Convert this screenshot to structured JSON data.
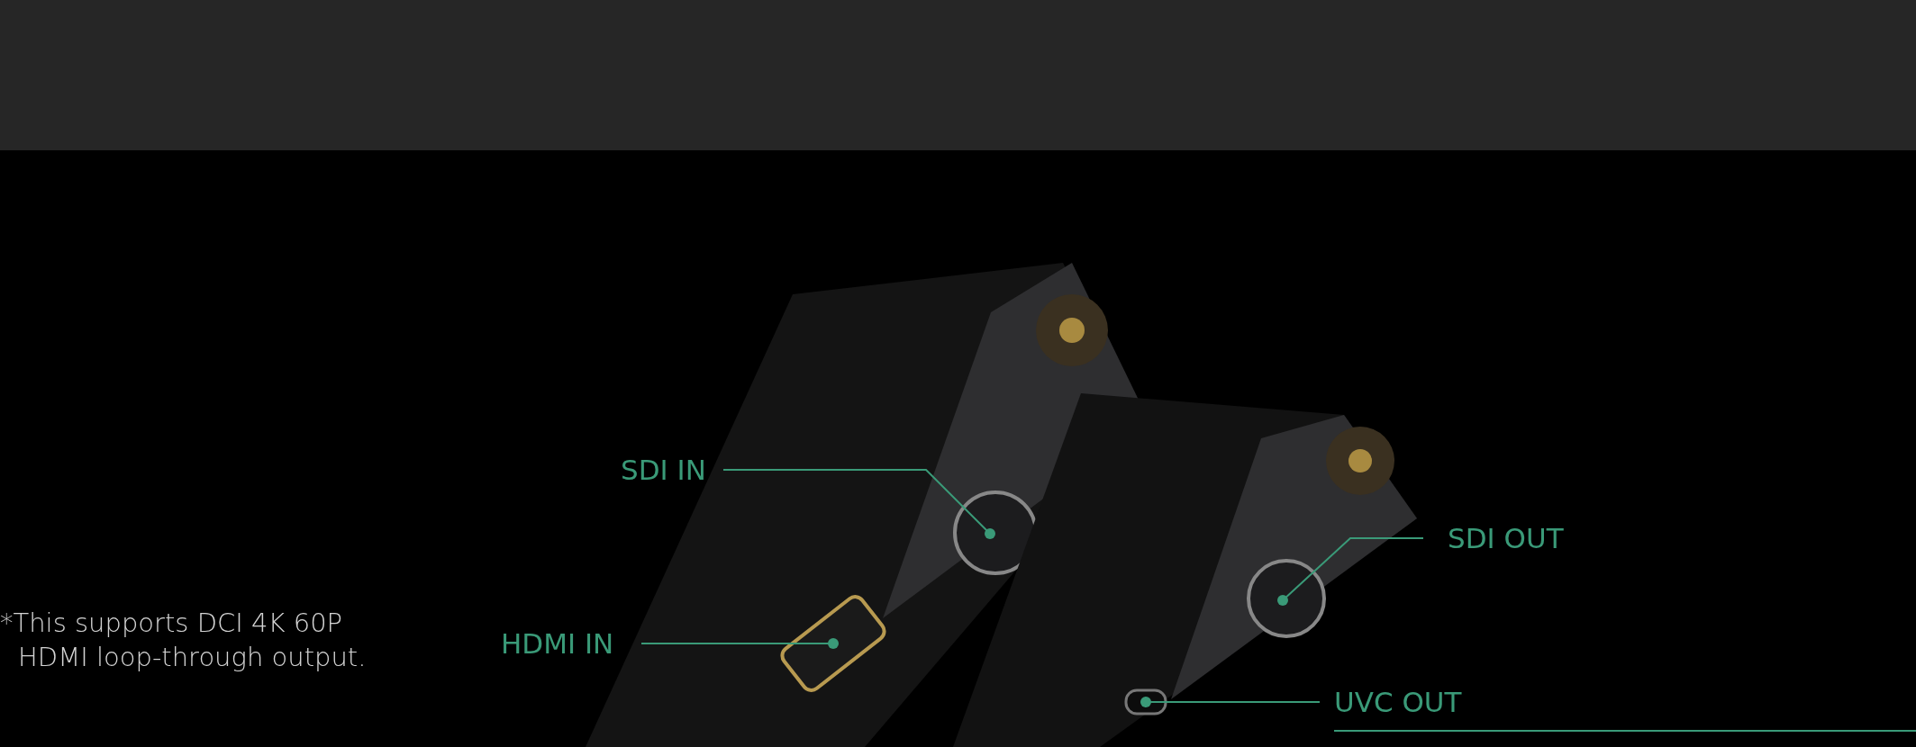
{
  "footnote": {
    "lines": [
      "*This supports DCI 4K 60P",
      "HDMI loop-through output."
    ]
  },
  "callouts": [
    {
      "label": "SDI IN"
    },
    {
      "label": "HDMI IN"
    },
    {
      "label": "SDI OUT"
    },
    {
      "label": "UVC OUT"
    }
  ]
}
